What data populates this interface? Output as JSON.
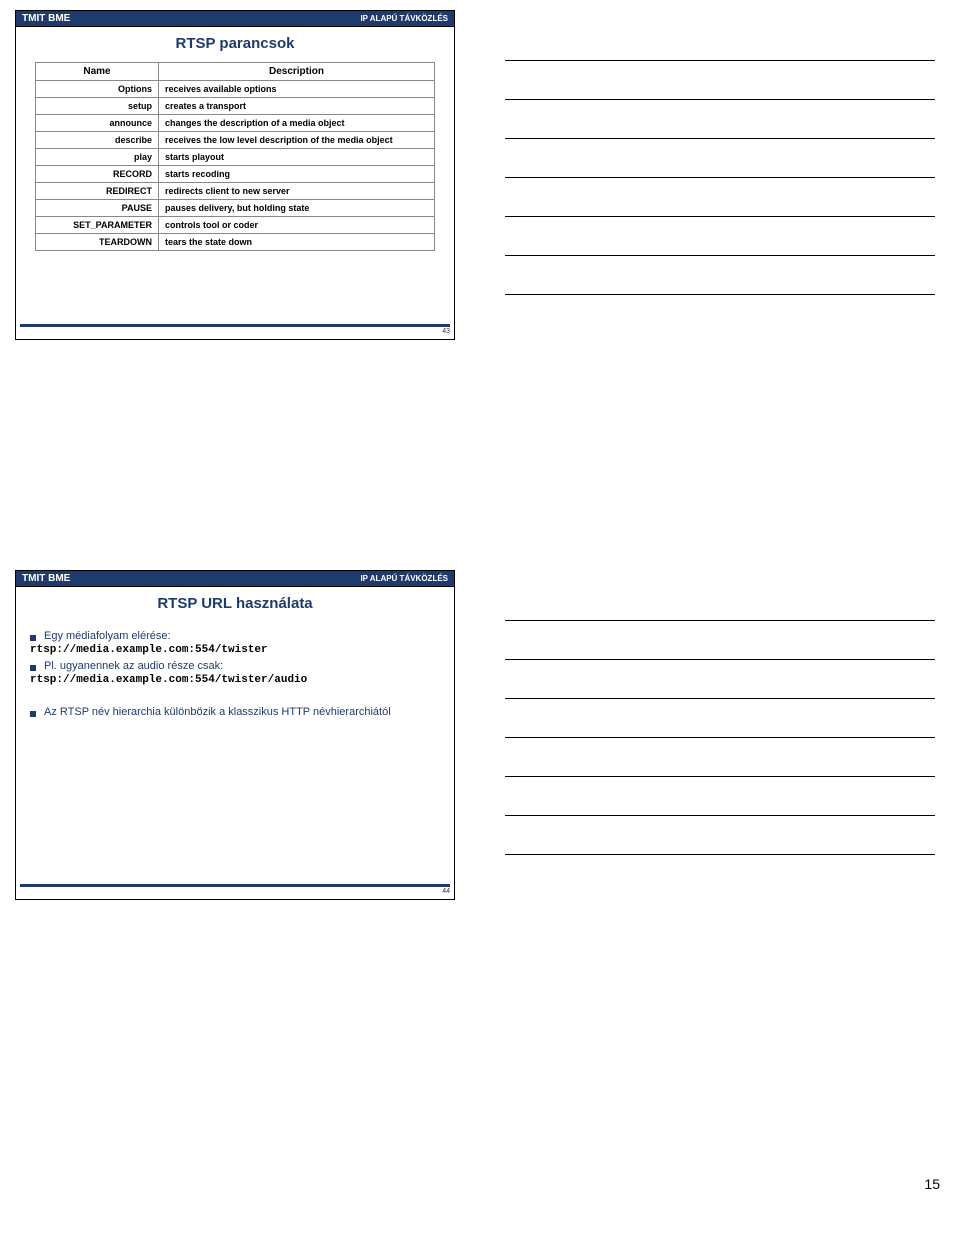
{
  "header": {
    "left": "TMIT BME",
    "right": "IP ALAPÚ TÁVKÖZLÉS"
  },
  "slide1": {
    "title": "RTSP parancsok",
    "table_headers": {
      "name": "Name",
      "desc": "Description"
    },
    "rows": [
      {
        "name": "Options",
        "desc": "receives available options"
      },
      {
        "name": "setup",
        "desc": "creates a transport"
      },
      {
        "name": "announce",
        "desc": "changes the description of a media object"
      },
      {
        "name": "describe",
        "desc": "receives the low level description of the media object"
      },
      {
        "name": "play",
        "desc": "starts playout"
      },
      {
        "name": "RECORD",
        "desc": "starts recoding"
      },
      {
        "name": "REDIRECT",
        "desc": "redirects client to new server"
      },
      {
        "name": "PAUSE",
        "desc": "pauses delivery, but holding state"
      },
      {
        "name": "SET_PARAMETER",
        "desc": "controls tool or coder"
      },
      {
        "name": "TEARDOWN",
        "desc": "tears the state down"
      }
    ],
    "page_num": "43"
  },
  "slide2": {
    "title": "RTSP URL használata",
    "bullet1": "Egy médiafolyam elérése:",
    "url1": "rtsp://media.example.com:554/twister",
    "bullet2": "Pl. ugyanennek az audio része csak:",
    "url2": "rtsp://media.example.com:554/twister/audio",
    "bullet3": "Az RTSP név hierarchia különbözik a klasszikus HTTP névhierarchiától",
    "page_num": "44"
  },
  "doc_page": "15"
}
